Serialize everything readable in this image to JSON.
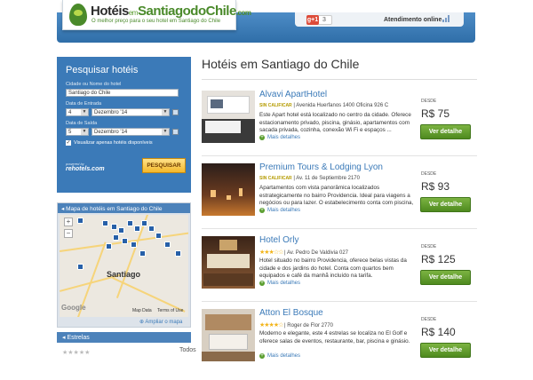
{
  "header": {
    "logo": {
      "part1": "Hotéis",
      "em": "em",
      "part2": "SantiagodoChile",
      "tld": ".com",
      "tagline": "O melhor preço para o seu hotel em Santiago do Chile"
    },
    "gplus_label": "g+1",
    "gplus_count": "3",
    "support_label": "Atendimento online"
  },
  "search": {
    "title": "Pesquisar hotéis",
    "city_label": "Cidade ou Nome do hotel",
    "city_value": "Santiago do Chile",
    "checkin_label": "Data de Entrada",
    "checkin_day": "4",
    "checkin_month": "Dezembro '14",
    "checkout_label": "Data de Saída",
    "checkout_day": "5",
    "checkout_month": "Dezembro '14",
    "available_only": "Visualizar apenas hotéis disponíveis",
    "partner_by": "powered by",
    "partner": "rehotels.com",
    "button": "PESQUISAR"
  },
  "map": {
    "title": "Mapa de hotéis em Santiago do Chile",
    "city_label": "Santiago",
    "google": "Google",
    "map_data": "Map Data",
    "terms": "Terms of Use",
    "zoom_in": "+",
    "zoom_out": "−",
    "expand": "Ampliar o mapa"
  },
  "filters": {
    "stars_title": "Estrelas",
    "stars_row_label": "Todos"
  },
  "main": {
    "page_title": "Hotéis em Santiago do Chile",
    "hotels": [
      {
        "name": "Alvavi ApartHotel",
        "rating": "SIN CALIFICAR",
        "stars": "",
        "address": "Avenida Huerfanos 1400 Oficina 926 C",
        "description": "Este Apart hotel está localizado no centro da cidade. Oferece estacionamento privado, piscina, ginásio, apartamentos com sacada privada, cozinha, conexão Wi Fi e espaços ...",
        "more": "Mais detalhes",
        "from": "DESDE",
        "price": "R$ 75",
        "button": "Ver detalhe"
      },
      {
        "name": "Premium Tours & Lodging Lyon",
        "rating": "SIN CALIFICAR",
        "stars": "",
        "address": "Av. 11 de Septiembre 2170",
        "description": "Apartamentos com vista panorâmica localizados estrategicamente no bairro Providencia. Ideal para viagens a negócios ou para lazer. O estabelecimento conta com piscina, ...",
        "more": "Mais detalhes",
        "from": "DESDE",
        "price": "R$ 93",
        "button": "Ver detalhe"
      },
      {
        "name": "Hotel Orly",
        "rating": "",
        "stars": "★★★☆☆",
        "address": "Av. Pedro De Valdivia 027",
        "description": "Hotel situado no bairro Providencia, oferece belas vistas da cidade e dos jardins do hotel. Conta com quartos bem equipados e café da manhã incluído na tarifa.",
        "more": "Mais detalhes",
        "from": "DESDE",
        "price": "R$ 125",
        "button": "Ver detalhe"
      },
      {
        "name": "Atton El Bosque",
        "rating": "",
        "stars": "★★★★☆",
        "address": "Roger de Flor 2770",
        "description": "Moderno e elegante, este 4 estrelas se localiza no El Golf e oferece salas de eventos, restaurante, bar, piscina e ginásio.",
        "more": "Mais detalhes",
        "from": "DESDE",
        "price": "R$ 140",
        "button": "Ver detalhe"
      }
    ]
  },
  "colors": {
    "brand_blue": "#3b7ab8",
    "brand_green": "#4a8a2a",
    "button_green": "#5a9e2f",
    "search_orange": "#f4b82a"
  }
}
